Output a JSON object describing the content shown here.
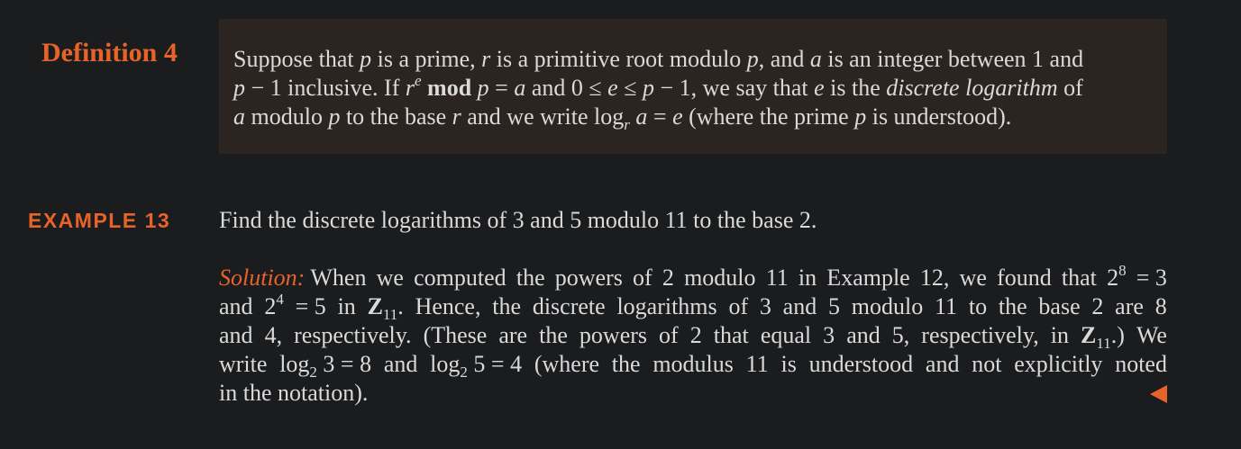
{
  "definition": {
    "label": "Definition 4",
    "lines": [
      [
        "Suppose that ",
        "p",
        " is a prime, ",
        "r",
        " is a primitive root modulo ",
        "p",
        ", and ",
        "a",
        " is an integer between 1 and"
      ],
      [
        "p",
        " − 1 inclusive. If ",
        "r",
        "e",
        "mod",
        "p",
        " = ",
        "a",
        " and 0 ≤ ",
        "e",
        " ≤ ",
        "p",
        " − 1, we say that ",
        "e",
        " is the ",
        "discrete logarithm",
        " of"
      ],
      [
        "a",
        " modulo ",
        "p",
        " to the base ",
        "r",
        " and we write log",
        "r",
        "a",
        " = ",
        "e",
        " (where the prime ",
        "p",
        " is understood)."
      ]
    ]
  },
  "example": {
    "label": "EXAMPLE 13",
    "question": "Find the discrete logarithms of 3 and 5 modulo 11 to the base 2.",
    "solution_heading": "Solution:",
    "solution_lines": [
      [
        " When",
        "we",
        "computed",
        "the",
        "powers",
        "of",
        "2",
        "modulo",
        "11",
        "in",
        "Example",
        "12,",
        "we",
        "found",
        "that",
        "2",
        "8",
        "= 3"
      ],
      [
        "and",
        "2",
        "4",
        "= 5",
        "in",
        "Z",
        "11",
        ".",
        "Hence,",
        "the",
        "discrete",
        "logarithms",
        "of",
        "3",
        "and",
        "5",
        "modulo",
        "11",
        "to",
        "the",
        "base",
        "2",
        "are",
        "8"
      ],
      [
        "and",
        "4,",
        "respectively.",
        "(These",
        "are",
        "the",
        "powers",
        "of",
        "2",
        "that",
        "equal",
        "3",
        "and",
        "5,",
        "respectively,",
        "in",
        "Z",
        "11",
        ".)",
        "We"
      ],
      [
        "write",
        "log",
        "2",
        "3 = 8",
        "and",
        "log",
        "2",
        "5 = 4",
        "(where",
        "the",
        "modulus",
        "11",
        "is",
        "understood",
        "and",
        "not",
        "explicitly",
        "noted"
      ],
      [
        "in",
        "the",
        "notation)."
      ]
    ]
  },
  "colors": {
    "accent": "#e8632a",
    "background": "#1b1c1e",
    "definition_box": "#2c2420",
    "text": "#dadada"
  },
  "icons": {
    "end_marker": "triangle-left-icon"
  }
}
